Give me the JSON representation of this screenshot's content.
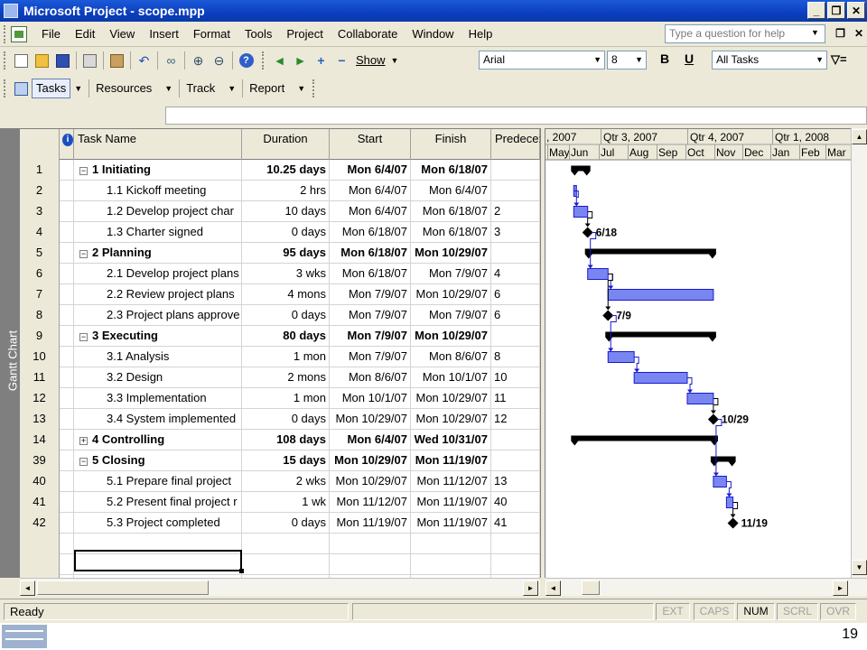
{
  "window": {
    "title": "Microsoft Project - scope.mpp",
    "controls": [
      "_",
      "❒",
      "✕"
    ]
  },
  "menu": {
    "items": [
      "File",
      "Edit",
      "View",
      "Insert",
      "Format",
      "Tools",
      "Project",
      "Collaborate",
      "Window",
      "Help"
    ],
    "ask_placeholder": "Type a question for help",
    "doc_controls": [
      "❒",
      "✕"
    ]
  },
  "toolbar": {
    "show_label": "Show",
    "font_name": "Arial",
    "font_size": "8",
    "bold_label": "B",
    "underline_label": "U",
    "filter": "All Tasks"
  },
  "guide_toolbar": {
    "items": [
      "Tasks",
      "Resources",
      "Track",
      "Report"
    ]
  },
  "view_label": "Gantt Chart",
  "table": {
    "headers": {
      "name": "Task Name",
      "duration": "Duration",
      "start": "Start",
      "finish": "Finish",
      "pred": "Predece:"
    },
    "rows": [
      {
        "id": "1",
        "name": "1 Initiating",
        "toggle": "−",
        "indent": 0,
        "summary": true,
        "duration": "10.25 days",
        "start": "Mon 6/4/07",
        "finish": "Mon 6/18/07",
        "pred": ""
      },
      {
        "id": "2",
        "name": "1.1 Kickoff meeting",
        "toggle": "",
        "indent": 1,
        "summary": false,
        "duration": "2 hrs",
        "start": "Mon 6/4/07",
        "finish": "Mon 6/4/07",
        "pred": ""
      },
      {
        "id": "3",
        "name": "1.2 Develop project char",
        "toggle": "",
        "indent": 1,
        "summary": false,
        "duration": "10 days",
        "start": "Mon 6/4/07",
        "finish": "Mon 6/18/07",
        "pred": "2"
      },
      {
        "id": "4",
        "name": "1.3 Charter signed",
        "toggle": "",
        "indent": 1,
        "summary": false,
        "duration": "0 days",
        "start": "Mon 6/18/07",
        "finish": "Mon 6/18/07",
        "pred": "3"
      },
      {
        "id": "5",
        "name": "2 Planning",
        "toggle": "−",
        "indent": 0,
        "summary": true,
        "duration": "95 days",
        "start": "Mon 6/18/07",
        "finish": "Mon 10/29/07",
        "pred": ""
      },
      {
        "id": "6",
        "name": "2.1 Develop project plans",
        "toggle": "",
        "indent": 1,
        "summary": false,
        "duration": "3 wks",
        "start": "Mon 6/18/07",
        "finish": "Mon 7/9/07",
        "pred": "4"
      },
      {
        "id": "7",
        "name": "2.2 Review project plans",
        "toggle": "",
        "indent": 1,
        "summary": false,
        "duration": "4 mons",
        "start": "Mon 7/9/07",
        "finish": "Mon 10/29/07",
        "pred": "6"
      },
      {
        "id": "8",
        "name": "2.3 Project plans approve",
        "toggle": "",
        "indent": 1,
        "summary": false,
        "duration": "0 days",
        "start": "Mon 7/9/07",
        "finish": "Mon 7/9/07",
        "pred": "6"
      },
      {
        "id": "9",
        "name": "3 Executing",
        "toggle": "−",
        "indent": 0,
        "summary": true,
        "duration": "80 days",
        "start": "Mon 7/9/07",
        "finish": "Mon 10/29/07",
        "pred": ""
      },
      {
        "id": "10",
        "name": "3.1 Analysis",
        "toggle": "",
        "indent": 1,
        "summary": false,
        "duration": "1 mon",
        "start": "Mon 7/9/07",
        "finish": "Mon 8/6/07",
        "pred": "8"
      },
      {
        "id": "11",
        "name": "3.2 Design",
        "toggle": "",
        "indent": 1,
        "summary": false,
        "duration": "2 mons",
        "start": "Mon 8/6/07",
        "finish": "Mon 10/1/07",
        "pred": "10"
      },
      {
        "id": "12",
        "name": "3.3 Implementation",
        "toggle": "",
        "indent": 1,
        "summary": false,
        "duration": "1 mon",
        "start": "Mon 10/1/07",
        "finish": "Mon 10/29/07",
        "pred": "11"
      },
      {
        "id": "13",
        "name": "3.4 System implemented",
        "toggle": "",
        "indent": 1,
        "summary": false,
        "duration": "0 days",
        "start": "Mon 10/29/07",
        "finish": "Mon 10/29/07",
        "pred": "12"
      },
      {
        "id": "14",
        "name": "4 Controlling",
        "toggle": "+",
        "indent": 0,
        "summary": true,
        "duration": "108 days",
        "start": "Mon 6/4/07",
        "finish": "Wed 10/31/07",
        "pred": ""
      },
      {
        "id": "39",
        "name": "5 Closing",
        "toggle": "−",
        "indent": 0,
        "summary": true,
        "duration": "15 days",
        "start": "Mon 10/29/07",
        "finish": "Mon 11/19/07",
        "pred": ""
      },
      {
        "id": "40",
        "name": "5.1 Prepare final project",
        "toggle": "",
        "indent": 1,
        "summary": false,
        "duration": "2 wks",
        "start": "Mon 10/29/07",
        "finish": "Mon 11/12/07",
        "pred": "13"
      },
      {
        "id": "41",
        "name": "5.2 Present final project r",
        "toggle": "",
        "indent": 1,
        "summary": false,
        "duration": "1 wk",
        "start": "Mon 11/12/07",
        "finish": "Mon 11/19/07",
        "pred": "40"
      },
      {
        "id": "42",
        "name": "5.3 Project completed",
        "toggle": "",
        "indent": 1,
        "summary": false,
        "duration": "0 days",
        "start": "Mon 11/19/07",
        "finish": "Mon 11/19/07",
        "pred": "41"
      }
    ]
  },
  "timescale": {
    "quarters": [
      ", 2007",
      "Qtr 3, 2007",
      "Qtr 4, 2007",
      "Qtr 1, 2008"
    ],
    "months": [
      "May",
      "Jun",
      "Jul",
      "Aug",
      "Sep",
      "Oct",
      "Nov",
      "Dec",
      "Jan",
      "Feb",
      "Mar"
    ]
  },
  "gantt": {
    "colors": {
      "task": "#7a86f0",
      "task_border": "#1a1acc",
      "summary": "#000000",
      "link": "#1a1acc",
      "milestone": "#000000"
    },
    "milestone_labels": {
      "4": "6/18",
      "8": "7/9",
      "13": "10/29",
      "42": "11/19"
    }
  },
  "status": {
    "ready": "Ready",
    "indicators": [
      {
        "label": "EXT",
        "on": false
      },
      {
        "label": "CAPS",
        "on": false
      },
      {
        "label": "NUM",
        "on": true
      },
      {
        "label": "SCRL",
        "on": false
      },
      {
        "label": "OVR",
        "on": false
      }
    ]
  },
  "slide": {
    "page_number": "19"
  }
}
